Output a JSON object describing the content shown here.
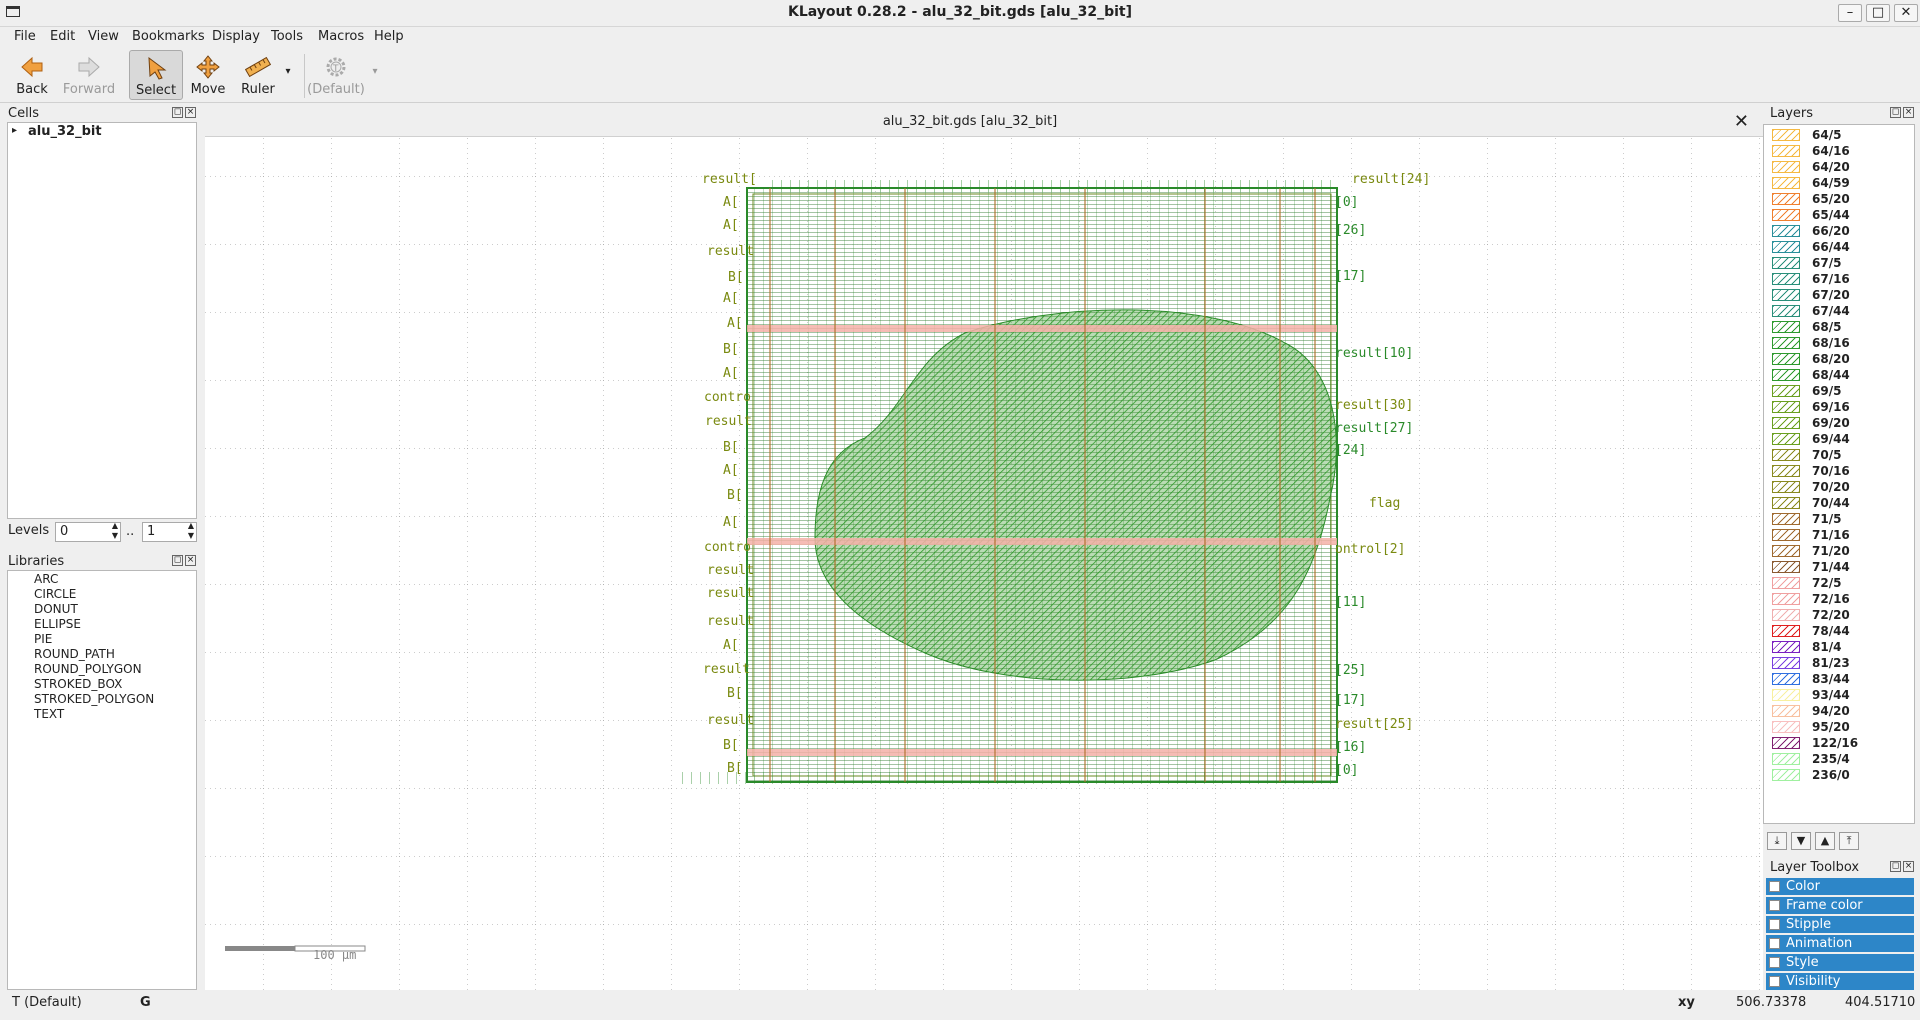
{
  "window": {
    "title": "KLayout 0.28.2 - alu_32_bit.gds [alu_32_bit]",
    "minimize": "–",
    "maximize": "□",
    "close": "✕"
  },
  "menu": [
    "File",
    "Edit",
    "View",
    "Bookmarks",
    "Display",
    "Tools",
    "Macros",
    "Help"
  ],
  "toolbar": {
    "back": "Back",
    "forward": "Forward",
    "select": "Select",
    "move": "Move",
    "ruler": "Ruler",
    "default": "(Default)"
  },
  "cells_panel": {
    "title": "Cells",
    "items": [
      "alu_32_bit"
    ]
  },
  "levels": {
    "label": "Levels",
    "from": "0",
    "sep": "..",
    "to": "1"
  },
  "libraries_panel": {
    "title": "Libraries",
    "items": [
      "ARC",
      "CIRCLE",
      "DONUT",
      "ELLIPSE",
      "PIE",
      "ROUND_PATH",
      "ROUND_POLYGON",
      "STROKED_BOX",
      "STROKED_POLYGON",
      "TEXT"
    ]
  },
  "view": {
    "tab_title": "alu_32_bit.gds [alu_32_bit]",
    "scale_label": "100 µm",
    "left_labels": [
      "result[",
      "A[",
      "A[",
      "result",
      "B[",
      "A[",
      "A[",
      "B[",
      "A[",
      "contro",
      "result",
      "B[",
      "A[",
      "B[",
      "A[",
      "contro",
      "result",
      "result",
      "result",
      "A[",
      "result",
      "B[",
      "result",
      "B[",
      "B["
    ],
    "right_labels": [
      "result[24]",
      "[0]",
      "[26]",
      "[17]",
      "result[10]",
      "result[30]",
      "result[27]",
      "[24]",
      "flag",
      "ontrol[2]",
      "[11]",
      "[25]",
      "[17]",
      "result[25]",
      "[16]",
      "[0]"
    ]
  },
  "layers_panel": {
    "title": "Layers",
    "layers": [
      {
        "name": "64/5",
        "color": "#f5b942"
      },
      {
        "name": "64/16",
        "color": "#f5b942"
      },
      {
        "name": "64/20",
        "color": "#f5b942"
      },
      {
        "name": "64/59",
        "color": "#f5b942"
      },
      {
        "name": "65/20",
        "color": "#f08030"
      },
      {
        "name": "65/44",
        "color": "#f08030"
      },
      {
        "name": "66/20",
        "color": "#2a8f9a"
      },
      {
        "name": "66/44",
        "color": "#2a8f9a"
      },
      {
        "name": "67/5",
        "color": "#2a8f7a"
      },
      {
        "name": "67/16",
        "color": "#2a8f7a"
      },
      {
        "name": "67/20",
        "color": "#2a8f7a"
      },
      {
        "name": "67/44",
        "color": "#2a8f7a"
      },
      {
        "name": "68/5",
        "color": "#2e9a2e"
      },
      {
        "name": "68/16",
        "color": "#2e9a2e"
      },
      {
        "name": "68/20",
        "color": "#2e9a2e"
      },
      {
        "name": "68/44",
        "color": "#2e9a2e"
      },
      {
        "name": "69/5",
        "color": "#6aa020"
      },
      {
        "name": "69/16",
        "color": "#6aa020"
      },
      {
        "name": "69/20",
        "color": "#6aa020"
      },
      {
        "name": "69/44",
        "color": "#6aa020"
      },
      {
        "name": "70/5",
        "color": "#8a8a20"
      },
      {
        "name": "70/16",
        "color": "#8a8a20"
      },
      {
        "name": "70/20",
        "color": "#8a8a20"
      },
      {
        "name": "70/44",
        "color": "#8a8a20"
      },
      {
        "name": "71/5",
        "color": "#a06a30"
      },
      {
        "name": "71/16",
        "color": "#a06a30"
      },
      {
        "name": "71/20",
        "color": "#a06a30"
      },
      {
        "name": "71/44",
        "color": "#8a5a30"
      },
      {
        "name": "72/5",
        "color": "#f0a0a0"
      },
      {
        "name": "72/16",
        "color": "#f0a0a0"
      },
      {
        "name": "72/20",
        "color": "#f0b0b0"
      },
      {
        "name": "78/44",
        "color": "#e02020"
      },
      {
        "name": "81/4",
        "color": "#7a20c0"
      },
      {
        "name": "81/23",
        "color": "#7a40e0"
      },
      {
        "name": "83/44",
        "color": "#3070e0"
      },
      {
        "name": "93/44",
        "color": "#f8f0a0"
      },
      {
        "name": "94/20",
        "color": "#f8c0a0"
      },
      {
        "name": "95/20",
        "color": "#f8c0c0"
      },
      {
        "name": "122/16",
        "color": "#802070"
      },
      {
        "name": "235/4",
        "color": "#a0f0a0"
      },
      {
        "name": "236/0",
        "color": "#a0f0a0"
      }
    ]
  },
  "layer_toolbox": {
    "title": "Layer Toolbox",
    "items": [
      "Color",
      "Frame color",
      "Stipple",
      "Animation",
      "Style",
      "Visibility"
    ]
  },
  "status": {
    "mode": "T  (Default)",
    "grid": "G",
    "coord_label": "xy",
    "x": "506.73378",
    "y": "404.51710"
  }
}
